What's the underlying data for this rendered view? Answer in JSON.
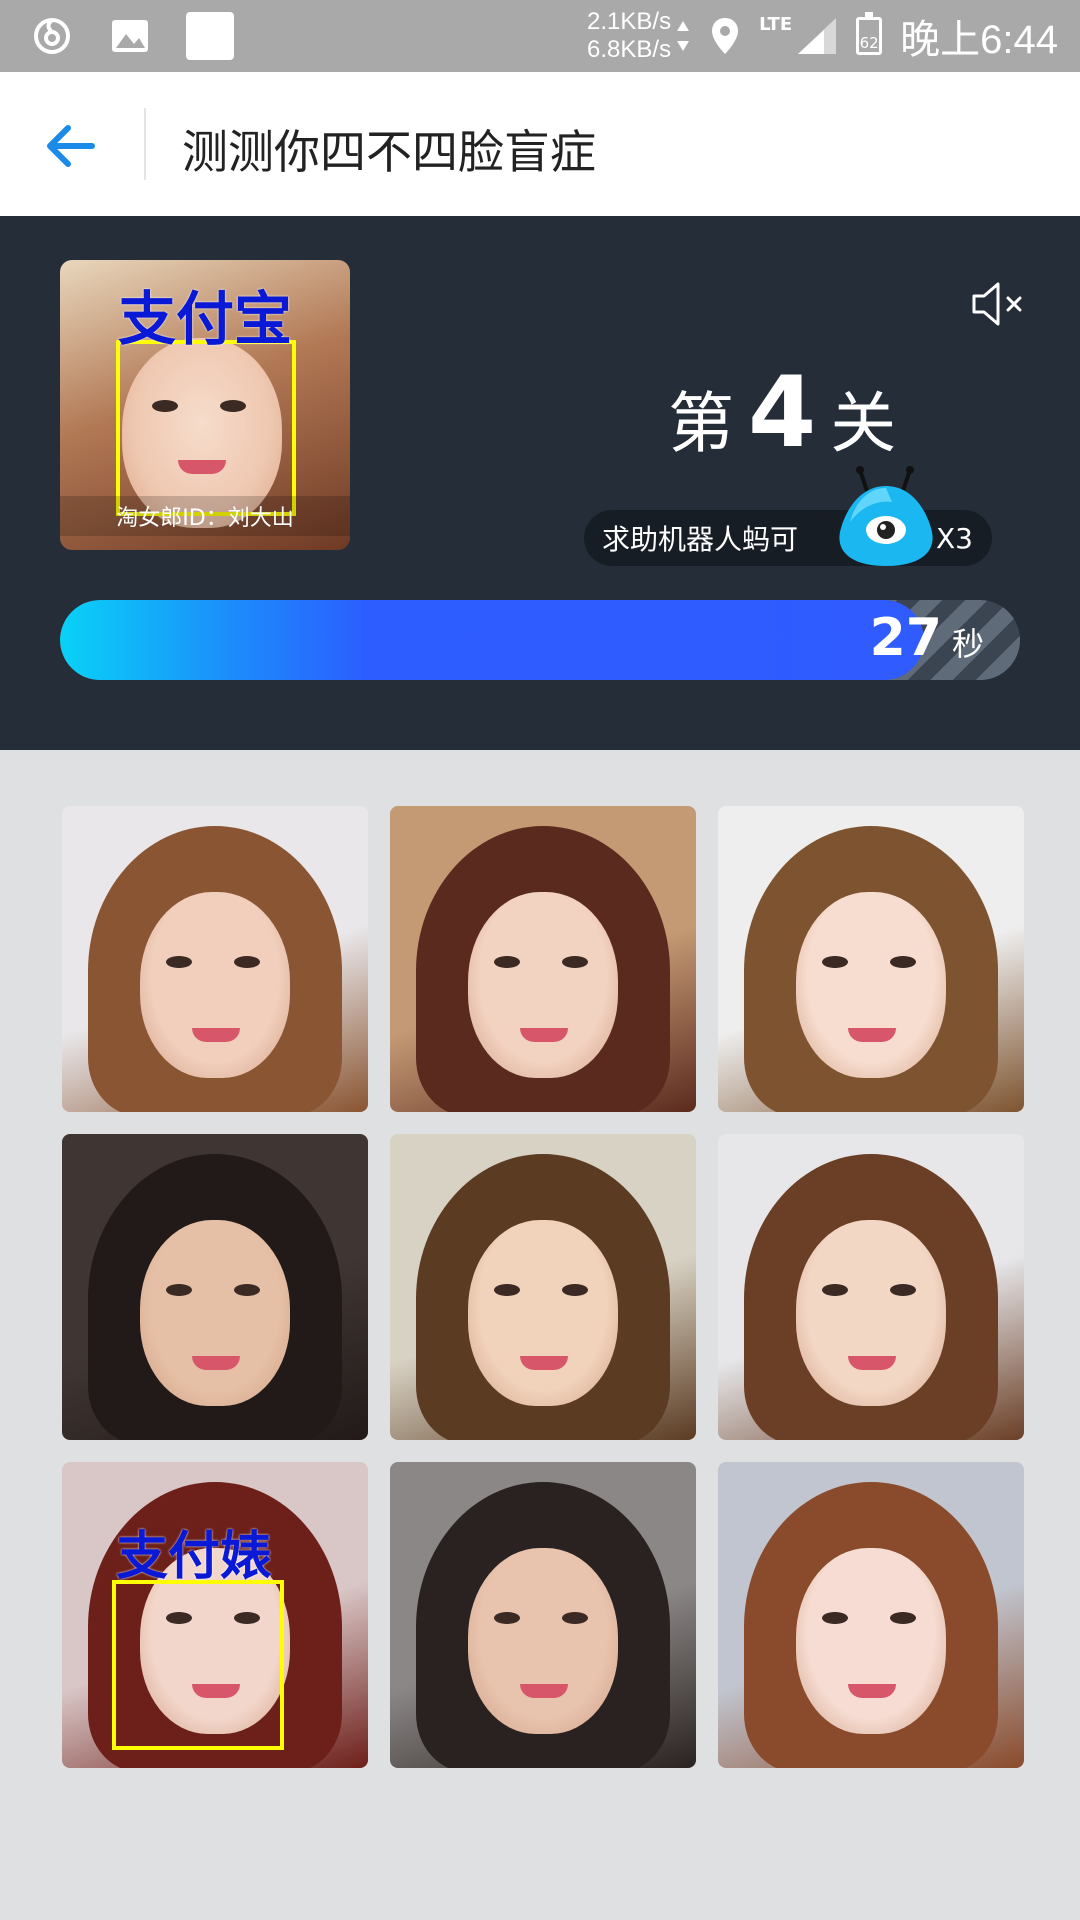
{
  "status_bar": {
    "net_up": "2.1KB/s",
    "net_down": "6.8KB/s",
    "network": "LTE",
    "battery": "62",
    "time": "晚上6:44",
    "icons": [
      "netease-cloud-music-icon",
      "image-icon",
      "white-square-icon",
      "location-icon",
      "signal-icon",
      "battery-icon"
    ]
  },
  "header": {
    "title": "测测你四不四脸盲症",
    "back_icon": "arrow-left-icon",
    "accent": "#1a8be8"
  },
  "game": {
    "target": {
      "tag": "支付宝",
      "caption": "淘女郎ID：刘大山"
    },
    "mute_icon": "speaker-muted-icon",
    "level": {
      "prefix": "第",
      "number": "4",
      "suffix": "关"
    },
    "help": {
      "label": "求助机器人蚂可",
      "count": "X3",
      "icon": "robot-mascot-icon"
    },
    "timer": {
      "value": "27",
      "unit": "秒",
      "fraction": 0.9
    }
  },
  "grid": {
    "photos": [
      {
        "bg": "#e9e7ea",
        "hair": "#8a5532",
        "skin": "#f1cfbc",
        "tag": ""
      },
      {
        "bg": "#c49a74",
        "hair": "#5b2a1e",
        "skin": "#f2d2c0",
        "tag": ""
      },
      {
        "bg": "#eeeeee",
        "hair": "#7e5430",
        "skin": "#f7ddcf",
        "tag": ""
      },
      {
        "bg": "#3f3633",
        "hair": "#221a18",
        "skin": "#e6c0a6",
        "tag": ""
      },
      {
        "bg": "#d8d2c4",
        "hair": "#5b3b22",
        "skin": "#f1d2bb",
        "tag": ""
      },
      {
        "bg": "#e7e7ea",
        "hair": "#6b3f26",
        "skin": "#f3d7c5",
        "tag": ""
      },
      {
        "bg": "#d9c6c6",
        "hair": "#6d1f1a",
        "skin": "#f3d6cb",
        "tag": "支付婊"
      },
      {
        "bg": "#8b8786",
        "hair": "#2a2220",
        "skin": "#e8c3ad",
        "tag": ""
      },
      {
        "bg": "#c1c5cf",
        "hair": "#8a4b2c",
        "skin": "#f6dcd2",
        "tag": ""
      }
    ]
  }
}
